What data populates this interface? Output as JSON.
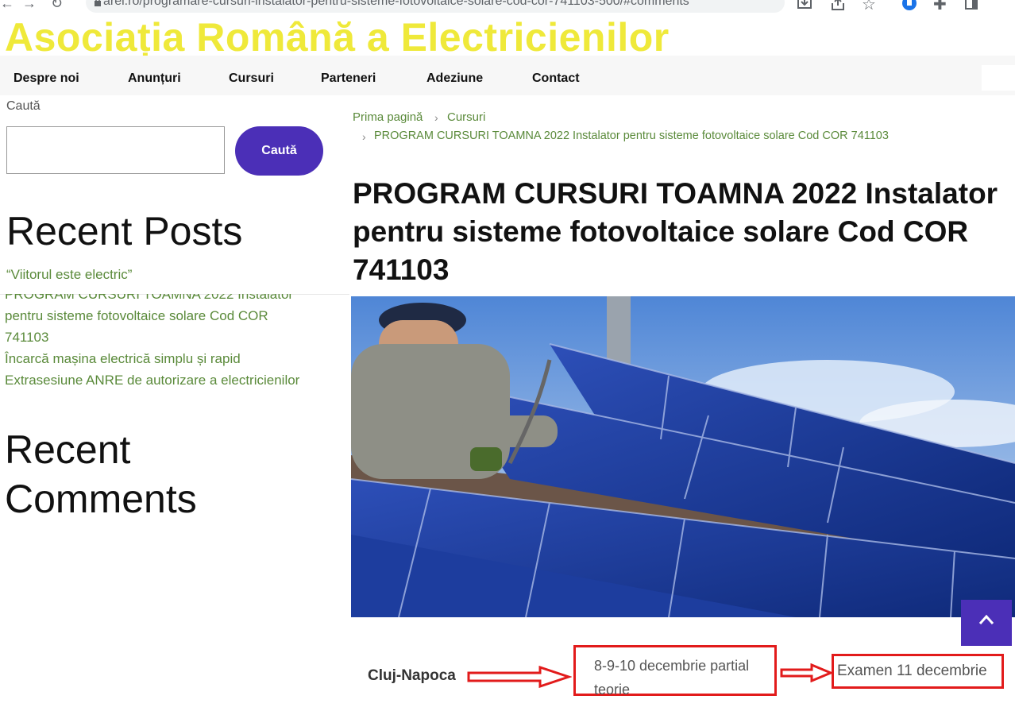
{
  "browser": {
    "url": "arei.ro/programare-cursuri-instalator-pentru-sisteme-fotovoltaice-solare-cod-cor-741103-500/#comments"
  },
  "site": {
    "title": "Asociația Română a Electricienilor"
  },
  "menu": {
    "items": [
      "Despre noi",
      "Anunțuri",
      "Cursuri",
      "Parteneri",
      "Adeziune",
      "Contact"
    ]
  },
  "sidebar": {
    "search_label": "Caută",
    "search_button": "Caută",
    "search_value": "",
    "recent_posts_heading": "Recent Posts",
    "recent_posts": [
      "“Viitorul este electric”",
      "PROGRAM CURSURI TOAMNA 2022 Instalator",
      "pentru sisteme fotovoltaice solare Cod COR",
      "741103",
      "Încarcă mașina electrică simplu și rapid",
      "Extrasesiune ANRE de autorizare a electricienilor"
    ],
    "recent_comments_heading_line1": "Recent",
    "recent_comments_heading_line2": "Comments"
  },
  "breadcrumb": {
    "home": "Prima pagină",
    "section": "Cursuri",
    "current": "PROGRAM CURSURI TOAMNA 2022 Instalator pentru sisteme fotovoltaice solare Cod COR 741103"
  },
  "post": {
    "title_line1": "PROGRAM CURSURI TOAMNA 2022 Instalator",
    "title_line2": "pentru sisteme fotovoltaice solare Cod COR",
    "title_line3": "741103"
  },
  "schedule": {
    "city": "Cluj-Napoca",
    "theory_dates": "8-9-10 decembrie partial teorie",
    "exam": "Examen  11 decembrie"
  },
  "colors": {
    "accent": "#4b2fb7",
    "site_title": "#efe93a",
    "link": "#5a8a3a",
    "annotation": "#e21b1b"
  }
}
